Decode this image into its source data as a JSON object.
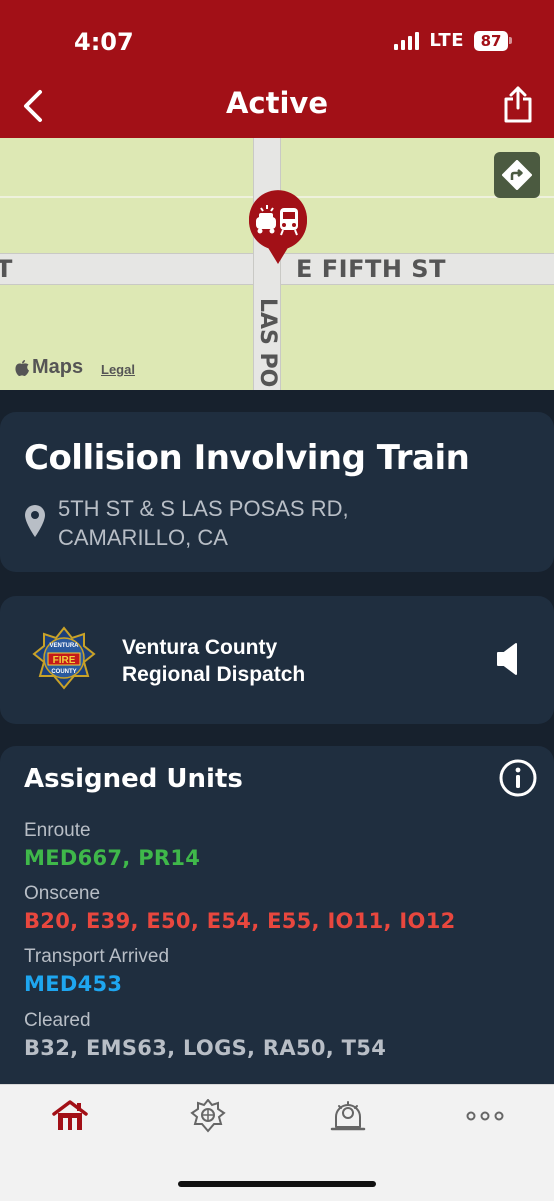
{
  "status_bar": {
    "time": "4:07",
    "network": "LTE",
    "battery": "87"
  },
  "header": {
    "title": "Active"
  },
  "map": {
    "street_horizontal": "E FIFTH ST",
    "street_left_fragment": "T",
    "street_vertical": "LAS PO",
    "maps_brand": "Maps",
    "legal_link": "Legal"
  },
  "incident": {
    "title": "Collision Involving Train",
    "address_line1": "5TH ST & S LAS POSAS RD,",
    "address_line2": "CAMARILLO, CA"
  },
  "agency": {
    "name_line1": "Ventura County",
    "name_line2": "Regional Dispatch",
    "logo_top": "VENTURA",
    "logo_mid": "FIRE",
    "logo_bottom": "COUNTY"
  },
  "units": {
    "title": "Assigned Units",
    "groups": [
      {
        "label": "Enroute",
        "values": "MED667, PR14",
        "color": "#3fb84a"
      },
      {
        "label": "Onscene",
        "values": "B20, E39, E50, E54, E55, IO11, IO12",
        "color": "#e8473e"
      },
      {
        "label": "Transport Arrived",
        "values": "MED453",
        "color": "#1ea6f0"
      },
      {
        "label": "Cleared",
        "values": "B32, EMS63, LOGS, RA50, T54",
        "color": "#b8bec6"
      }
    ]
  },
  "tabs": [
    {
      "icon": "home-icon",
      "active": true
    },
    {
      "icon": "fire-emblem-icon",
      "active": false
    },
    {
      "icon": "alert-bell-icon",
      "active": false
    },
    {
      "icon": "more-icon",
      "active": false
    }
  ],
  "colors": {
    "brand": "#a21017",
    "card": "#1f2e3f",
    "background": "#17212d"
  }
}
